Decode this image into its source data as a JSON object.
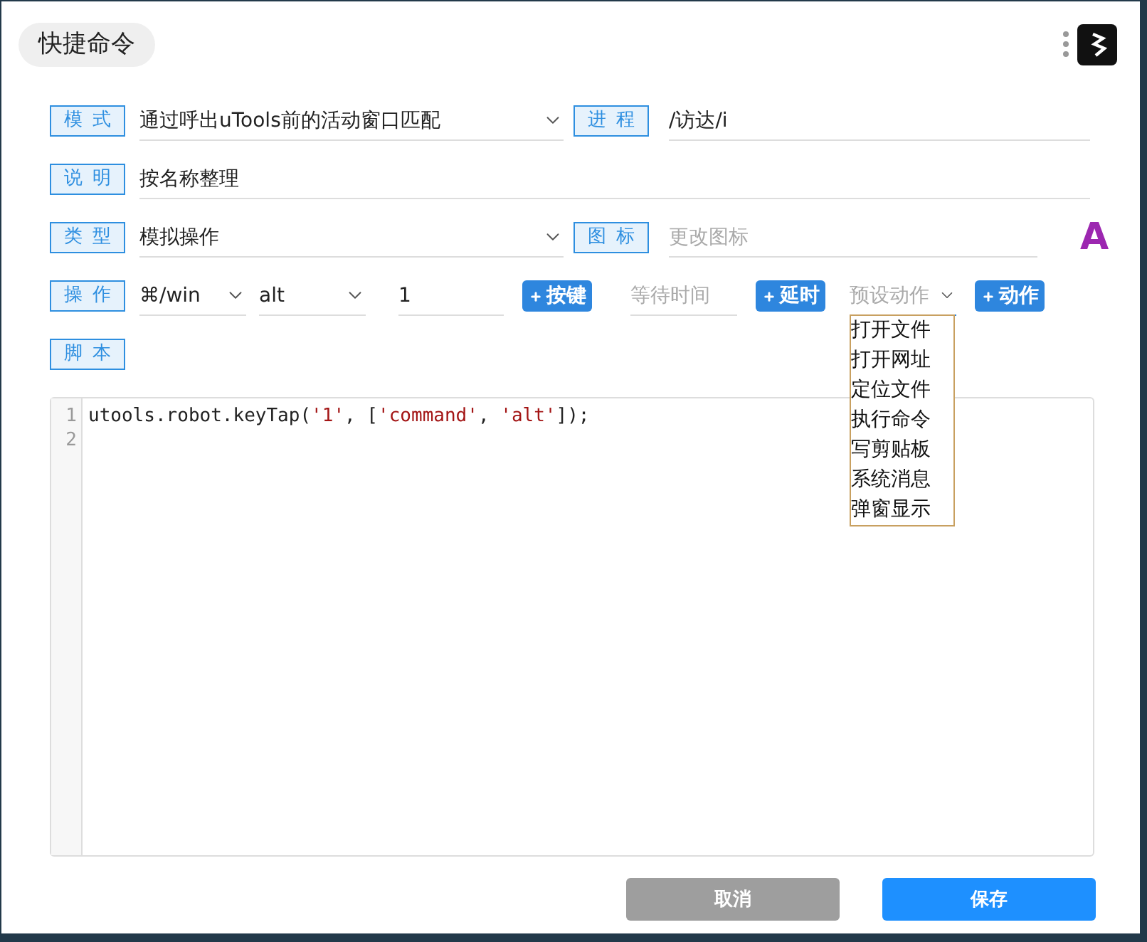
{
  "header": {
    "title": "快捷命令"
  },
  "mode": {
    "label": "模式",
    "value": "通过呼出uTools前的活动窗口匹配"
  },
  "process": {
    "label": "进程",
    "value": "/访达/i"
  },
  "description": {
    "label": "说明",
    "value": "按名称整理"
  },
  "type": {
    "label": "类型",
    "value": "模拟操作"
  },
  "icon": {
    "label": "图标",
    "placeholder": "更改图标",
    "preview": "A"
  },
  "operation": {
    "label": "操作",
    "modifier": "⌘/win",
    "modifier_2": "alt",
    "key": "1",
    "add_key": "按键",
    "wait_placeholder": "等待时间",
    "add_delay": "延时",
    "preset_placeholder": "预设动作",
    "preset_expanded": true,
    "add_action": "动作",
    "preset_options": [
      {
        "label": "打开文件"
      },
      {
        "label": "打开网址"
      },
      {
        "label": "定位文件"
      },
      {
        "label": "执行命令"
      },
      {
        "label": "写剪贴板"
      },
      {
        "label": "系统消息"
      },
      {
        "label": "弹窗显示"
      }
    ]
  },
  "script": {
    "label": "脚本",
    "lines": [
      {
        "number": "1",
        "tokens": [
          {
            "kind": "plain",
            "text": "utools.robot.keyTap("
          },
          {
            "kind": "string",
            "text": "'1'"
          },
          {
            "kind": "plain",
            "text": ", ["
          },
          {
            "kind": "string",
            "text": "'command'"
          },
          {
            "kind": "plain",
            "text": ", "
          },
          {
            "kind": "string",
            "text": "'alt'"
          },
          {
            "kind": "plain",
            "text": "]);"
          }
        ]
      },
      {
        "number": "2"
      }
    ]
  },
  "buttons": [
    {
      "label": "取消",
      "kind": "cancel"
    },
    {
      "label": "保存",
      "kind": "primary"
    }
  ]
}
